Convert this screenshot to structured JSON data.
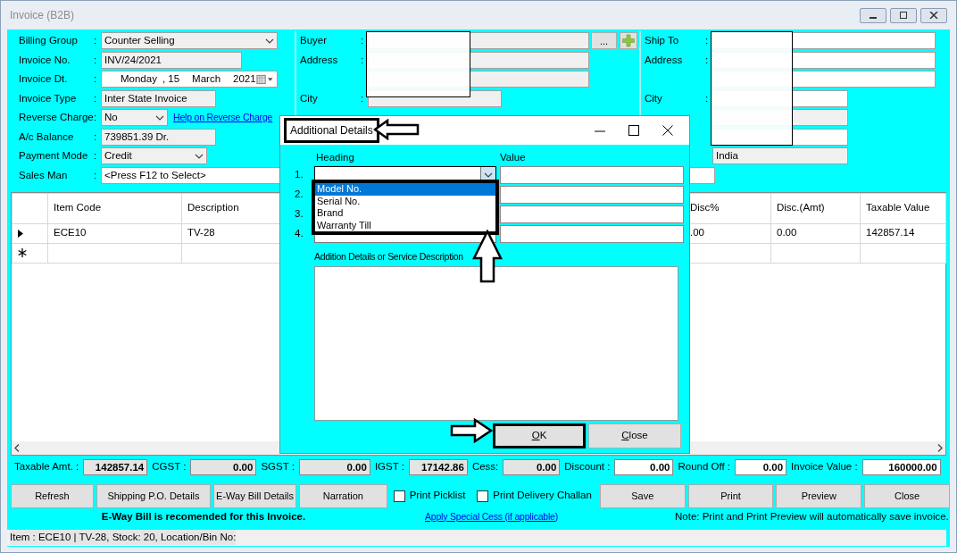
{
  "window": {
    "title": "Invoice (B2B)"
  },
  "header_left": [
    {
      "label": "Billing Group",
      "kind": "select",
      "value": "Counter Selling"
    },
    {
      "label": "Invoice No.",
      "kind": "text",
      "value": "INV/24/2021"
    },
    {
      "label": "Invoice Dt.",
      "kind": "date",
      "parts": [
        "Monday",
        ", 15",
        "March",
        "2021"
      ]
    },
    {
      "label": "Invoice Type",
      "kind": "text",
      "value": "Inter State Invoice"
    },
    {
      "label": "Reverse Charge",
      "kind": "select",
      "value": "No",
      "link": "Help on Reverse Charge"
    },
    {
      "label": "A/c Balance",
      "kind": "text",
      "value": "739851.39 Dr."
    },
    {
      "label": "Payment Mode",
      "kind": "select",
      "value": "Credit"
    }
  ],
  "buyer": [
    {
      "label": "Buyer",
      "kind": "lookup"
    },
    {
      "label": "Address",
      "kind": "text"
    },
    {
      "kind": "text"
    },
    {
      "label": "City",
      "kind": "short"
    }
  ],
  "buyer_lookup_button": "...",
  "ship_to": [
    {
      "label": "Ship To",
      "kind": "text",
      "editable": true
    },
    {
      "label": "Address",
      "kind": "text",
      "editable": true
    },
    {
      "kind": "text",
      "editable": true
    },
    {
      "label": "City",
      "kind": "short",
      "editable": true
    },
    {
      "kind": "short",
      "editable": false
    },
    {
      "kind": "short",
      "editable": true
    },
    {
      "kind": "short",
      "editable": false,
      "value": "India"
    }
  ],
  "sales_man": {
    "label": "Sales Man",
    "value": "<Press F12 to Select>"
  },
  "grid": {
    "columns": [
      "Item Code",
      "Description",
      "Disc%",
      "Disc.(Amt)",
      "Taxable Value"
    ],
    "rows": [
      {
        "kind": "current",
        "cells": [
          "ECE10",
          "TV-28",
          ".00",
          "0.00",
          "142857.14"
        ]
      },
      {
        "kind": "new",
        "cells": []
      }
    ]
  },
  "label_colons": {
    "header_left": [
      ":",
      ":",
      ":",
      ":",
      ":",
      ":",
      ":"
    ],
    "buyer": [
      ":",
      ":",
      ":"
    ],
    "ship_to": [
      ":",
      ":",
      ":"
    ],
    "sales_man": ":"
  },
  "totals": [
    {
      "label": "Taxable Amt. :",
      "value": "142857.14",
      "editable": false
    },
    {
      "label": "CGST :",
      "value": "0.00",
      "editable": false
    },
    {
      "label": "SGST :",
      "value": "0.00",
      "editable": false
    },
    {
      "label": "IGST :",
      "value": "17142.86",
      "editable": false
    },
    {
      "label": "Cess:",
      "value": "0.00",
      "editable": false
    },
    {
      "label": "Discount :",
      "value": "0.00",
      "editable": true
    },
    {
      "label": "Round Off :",
      "value": "0.00",
      "editable": true
    },
    {
      "label": "Invoice Value :",
      "value": "160000.00",
      "editable": true
    }
  ],
  "buttons_left": [
    "Refresh",
    "Shipping P.O. Details",
    "E-Way Bill Details",
    "Narration"
  ],
  "checkboxes": [
    {
      "label": "Print Picklist",
      "checked": false
    },
    {
      "label": "Print Delivery Challan",
      "checked": false
    }
  ],
  "buttons_right": [
    "Save",
    "Print",
    "Preview",
    "Close"
  ],
  "eway_note": "E-Way Bill is recomended for this Invoice.",
  "special_cess_link": "Apply Special Cess (if applicable)",
  "save_note": "Note: Print and Print Preview will automatically save invoice.",
  "status_bar": "Item : ECE10 | TV-28, Stock: 20, Location/Bin No:",
  "dialog": {
    "title": "Additional Details",
    "heading_label": "Heading",
    "value_label": "Value",
    "rows": [
      {
        "number": "1.",
        "expanded": true
      },
      {
        "number": "2.",
        "expanded": false
      },
      {
        "number": "3.",
        "expanded": false
      },
      {
        "number": "4.",
        "expanded": false
      }
    ],
    "dropdown": [
      {
        "label": "Model No.",
        "selected": true
      },
      {
        "label": "Serial No.",
        "selected": false
      },
      {
        "label": "Brand",
        "selected": false
      },
      {
        "label": "Warranty Till",
        "selected": false
      }
    ],
    "description_label": "Addition Details or Service Description",
    "buttons": [
      "OK",
      "Close"
    ]
  }
}
